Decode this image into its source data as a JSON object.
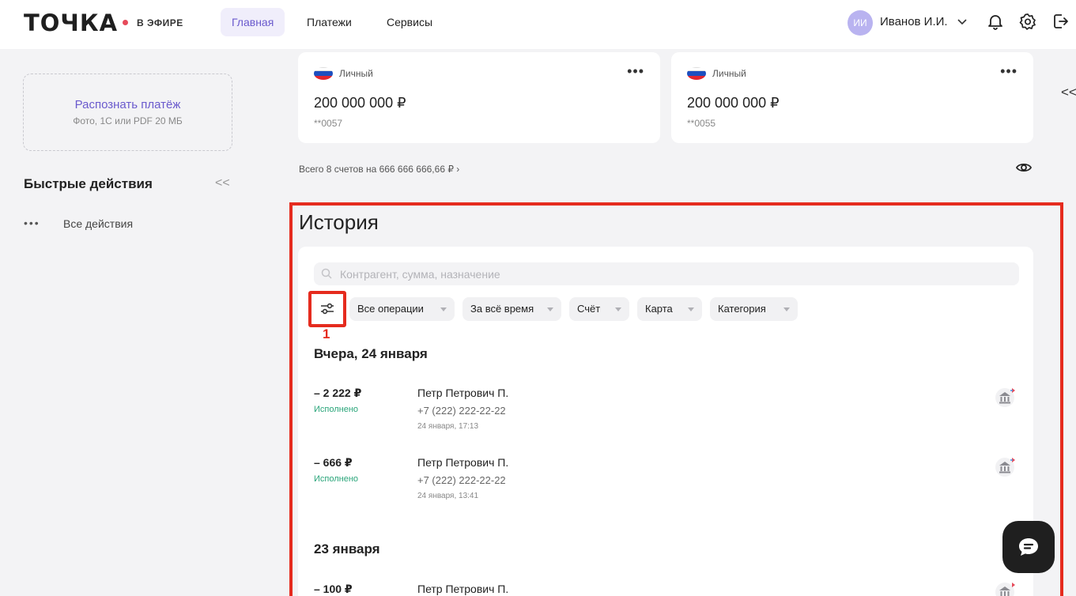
{
  "header": {
    "logo": "ТОЧКА",
    "live_label": "В ЭФИРЕ",
    "nav": [
      {
        "label": "Главная",
        "active": true
      },
      {
        "label": "Платежи",
        "active": false
      },
      {
        "label": "Сервисы",
        "active": false
      }
    ],
    "user": {
      "initials": "ИИ",
      "name": "Иванов И.И."
    },
    "icons": [
      "bell-icon",
      "gear-icon",
      "logout-icon"
    ]
  },
  "sidebar": {
    "recognize": {
      "title": "Распознать платёж",
      "subtitle": "Фото, 1С или PDF 20 МБ"
    },
    "quick_actions": {
      "title": "Быстрые действия",
      "collapse": "<<",
      "all_actions_dots": "•••",
      "all_actions": "Все действия"
    }
  },
  "accounts": [
    {
      "type": "Личный",
      "amount": "200 000 000 ₽",
      "number": "**0057",
      "more": "•••"
    },
    {
      "type": "Личный",
      "amount": "200 000 000 ₽",
      "number": "**0055",
      "more": "•••"
    }
  ],
  "accounts_total": "Всего 8 счетов на 666 666 666,66 ₽  ›",
  "right_collapse": "<<",
  "history": {
    "title": "История",
    "search_placeholder": "Контрагент, сумма, назначение",
    "filters": [
      "Все операции",
      "За всё время",
      "Счёт",
      "Карта",
      "Категория"
    ],
    "marker": "1",
    "groups": [
      {
        "date": "Вчера, 24 января",
        "transactions": [
          {
            "amount": "– 2 222 ₽",
            "status": "Исполнено",
            "name": "Петр Петрович П.",
            "phone": "+7 (222) 222-22-22",
            "time": "24 января, 17:13"
          },
          {
            "amount": "– 666 ₽",
            "status": "Исполнено",
            "name": "Петр Петрович П.",
            "phone": "+7 (222) 222-22-22",
            "time": "24 января, 13:41"
          }
        ]
      },
      {
        "date": "23 января",
        "transactions": [
          {
            "amount": "– 100 ₽",
            "name": "Петр Петрович П."
          }
        ]
      }
    ]
  },
  "colors": {
    "accent": "#6a5acd",
    "status_success": "#2aa57a",
    "highlight": "#e52b1e",
    "live_dot": "#e64a5a"
  }
}
